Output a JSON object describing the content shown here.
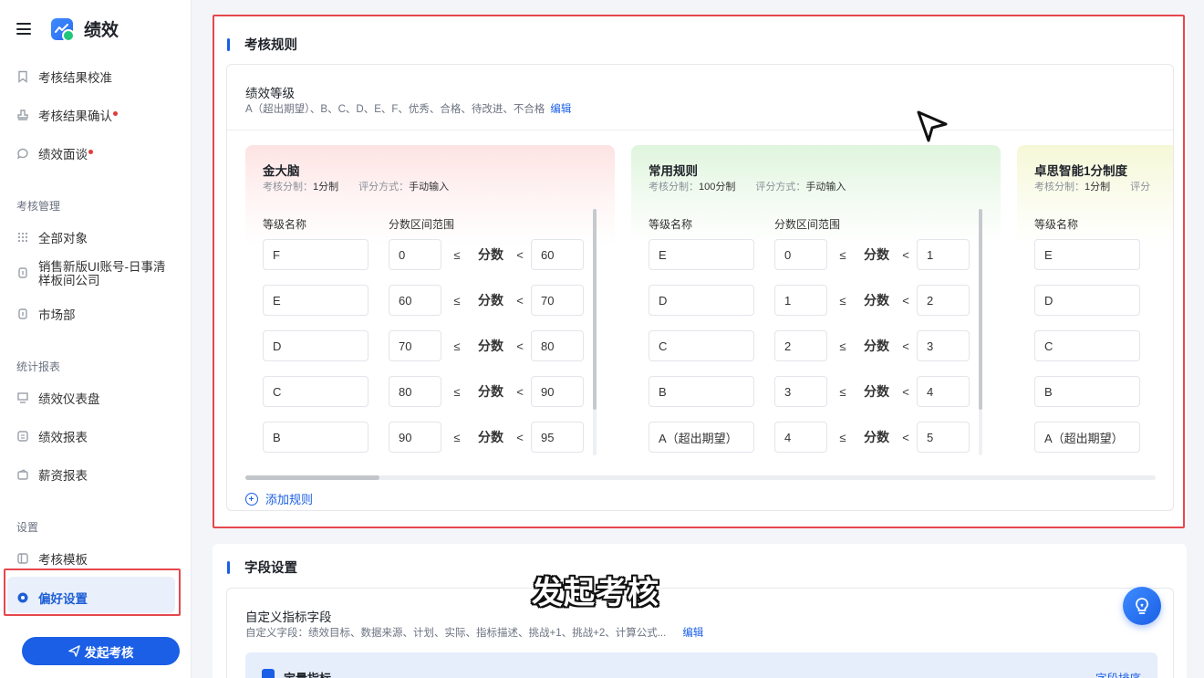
{
  "app": {
    "title": "绩效"
  },
  "sidebar": {
    "items_top": [
      {
        "label": "考核结果校准",
        "icon": "bookmark-icon",
        "dot": false
      },
      {
        "label": "考核结果确认",
        "icon": "stamp-icon",
        "dot": true
      },
      {
        "label": "绩效面谈",
        "icon": "chat-icon",
        "dot": true
      }
    ],
    "section_manage": "考核管理",
    "items_manage": [
      {
        "label": "全部对象",
        "icon": "grid-dots-icon"
      },
      {
        "label": "销售新版UI账号-日事清样板间公司",
        "icon": "building-icon"
      },
      {
        "label": "市场部",
        "icon": "building-icon"
      }
    ],
    "section_reports": "统计报表",
    "items_reports": [
      {
        "label": "绩效仪表盘",
        "icon": "dashboard-icon"
      },
      {
        "label": "绩效报表",
        "icon": "report-icon"
      },
      {
        "label": "薪资报表",
        "icon": "wallet-icon"
      }
    ],
    "section_settings": "设置",
    "items_settings": [
      {
        "label": "考核模板",
        "icon": "template-icon"
      },
      {
        "label": "偏好设置",
        "icon": "settings-icon",
        "active": true
      }
    ],
    "launch_button": "发起考核"
  },
  "rules": {
    "title": "考核规则",
    "grade_title": "绩效等级",
    "grade_desc": "A（超出期望）、B、C、D、E、F、优秀、合格、待改进、不合格",
    "edit_link": "编辑",
    "add_rule": "添加规则",
    "col_name": "等级名称",
    "col_range": "分数区间范围",
    "op_le": "≤",
    "op_label": "分数",
    "op_lt": "<",
    "meta_split_label": "考核分制：",
    "meta_mode_label": "评分方式：",
    "cards": [
      {
        "name": "金大脑",
        "split": "1分制",
        "mode": "手动输入",
        "color": "#fde3e3",
        "rows": [
          {
            "grade": "F",
            "min": "0",
            "max": "60"
          },
          {
            "grade": "E",
            "min": "60",
            "max": "70"
          },
          {
            "grade": "D",
            "min": "70",
            "max": "80"
          },
          {
            "grade": "C",
            "min": "80",
            "max": "90"
          },
          {
            "grade": "B",
            "min": "90",
            "max": "95"
          }
        ]
      },
      {
        "name": "常用规则",
        "split": "100分制",
        "mode": "手动输入",
        "color": "#dff5dd",
        "rows": [
          {
            "grade": "E",
            "min": "0",
            "max": "1"
          },
          {
            "grade": "D",
            "min": "1",
            "max": "2"
          },
          {
            "grade": "C",
            "min": "2",
            "max": "3"
          },
          {
            "grade": "B",
            "min": "3",
            "max": "4"
          },
          {
            "grade": "A（超出期望）",
            "min": "4",
            "max": "5"
          }
        ]
      },
      {
        "name": "卓思智能1分制度",
        "split": "1分制",
        "mode": "评分",
        "color": "#f5f8d6",
        "rows": [
          {
            "grade": "E"
          },
          {
            "grade": "D"
          },
          {
            "grade": "C"
          },
          {
            "grade": "B"
          },
          {
            "grade": "A（超出期望）"
          }
        ]
      }
    ]
  },
  "fields": {
    "title": "字段设置",
    "custom_title": "自定义指标字段",
    "custom_desc": "自定义字段：绩效目标、数据来源、计划、实际、指标描述、挑战+1、挑战+2、计算公式...",
    "edit_link": "编辑",
    "quant_label": "定量指标",
    "quant_right": "字段排序"
  },
  "overlay": {
    "subtitle": "发起考核"
  },
  "colors": {
    "accent": "#1a5fe6",
    "highlight": "#e5484d"
  }
}
